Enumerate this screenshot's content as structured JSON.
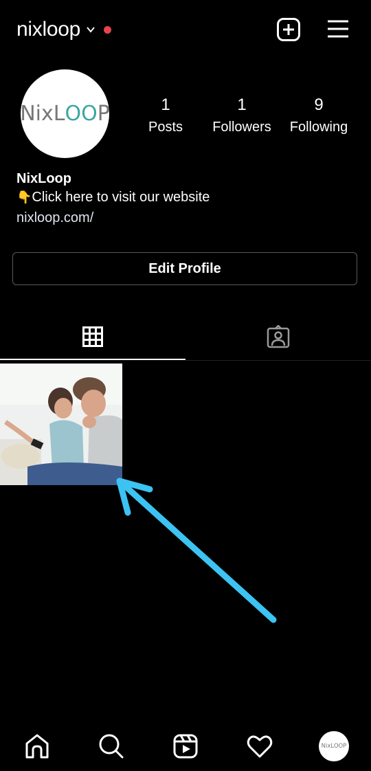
{
  "header": {
    "username": "nixloop",
    "notification_dot_color": "#e8434f",
    "icons": {
      "new_post": "plus-square-icon",
      "menu": "hamburger-menu-icon",
      "dropdown": "chevron-down-icon"
    }
  },
  "profile": {
    "avatar_logo": {
      "prefix": "NixL",
      "loop": "OO",
      "suffix": "P"
    },
    "stats": [
      {
        "value": "1",
        "label": "Posts"
      },
      {
        "value": "1",
        "label": "Followers"
      },
      {
        "value": "9",
        "label": "Following"
      }
    ],
    "display_name": "NixLoop",
    "bio_emoji": "👇",
    "bio_text": "Click here to visit our website",
    "website": "nixloop.com/",
    "edit_profile_label": "Edit Profile"
  },
  "tabs": [
    {
      "name": "grid",
      "icon": "grid-icon",
      "active": true
    },
    {
      "name": "tagged",
      "icon": "tagged-person-icon",
      "active": false
    }
  ],
  "posts": [
    {
      "description": "Photo of a couple on a couch looking shocked at a phone"
    }
  ],
  "annotation": {
    "type": "arrow",
    "color": "#3cc3f2",
    "points_to": "first post"
  },
  "bottom_nav": {
    "items": [
      "home-icon",
      "search-icon",
      "reels-icon",
      "heart-icon",
      "profile-avatar"
    ],
    "avatar_text": "NixLOOP"
  }
}
